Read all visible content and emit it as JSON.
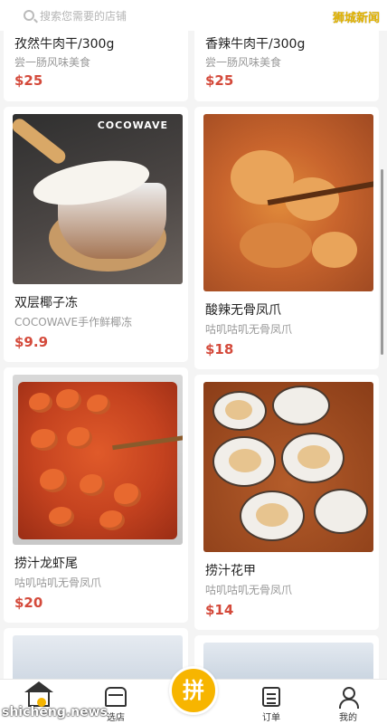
{
  "search": {
    "placeholder": "搜索您需要的店铺"
  },
  "watermark": {
    "top": "狮城新闻",
    "bottom": "shicheng.news"
  },
  "products": [
    {
      "name": "孜然牛肉干/300g",
      "sub": "尝一肠风味美食",
      "price": "$25"
    },
    {
      "name": "香辣牛肉干/300g",
      "sub": "尝一肠风味美食",
      "price": "$25"
    },
    {
      "name": "双层椰子冻",
      "sub": "COCOWAVE手作鲜椰冻",
      "price": "$9.9",
      "brand": "COCOWAVE"
    },
    {
      "name": "酸辣无骨凤爪",
      "sub": "咕叽咕叽无骨凤爪",
      "price": "$18"
    },
    {
      "name": "捞汁龙虾尾",
      "sub": "咕叽咕叽无骨凤爪",
      "price": "$20"
    },
    {
      "name": "捞汁花甲",
      "sub": "咕叽咕叽无骨凤爪",
      "price": "$14"
    }
  ],
  "tabs": [
    {
      "label": "",
      "icon": "home-icon"
    },
    {
      "label": "选店",
      "icon": "store-icon"
    },
    {
      "label": "拼",
      "icon": "group-buy-icon"
    },
    {
      "label": "订单",
      "icon": "order-icon"
    },
    {
      "label": "我的",
      "icon": "user-icon"
    }
  ],
  "colors": {
    "price": "#d44a3b",
    "accent": "#f7b500",
    "watermark": "#e2b300"
  }
}
